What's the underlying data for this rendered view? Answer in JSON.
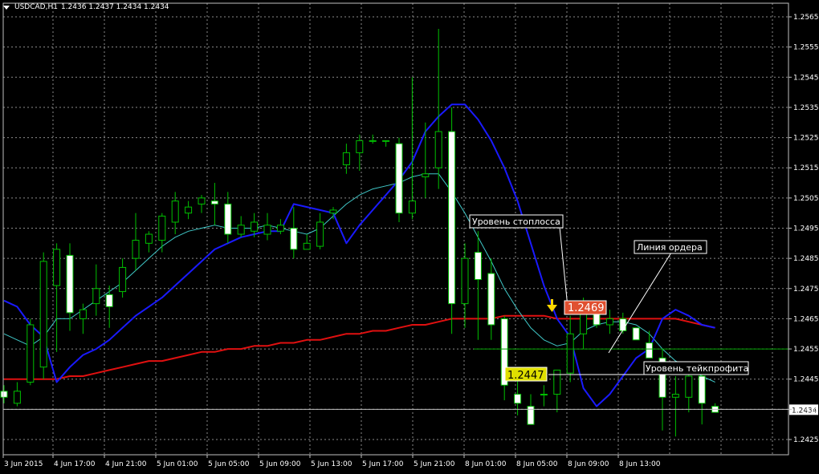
{
  "header": {
    "symbol": "USDCAD,H1",
    "ohlc": "1.2436 1.2437 1.2434 1.2434"
  },
  "price_axis": {
    "labels": [
      "1.2565",
      "1.2555",
      "1.2545",
      "1.2535",
      "1.2525",
      "1.2515",
      "1.2505",
      "1.2495",
      "1.2485",
      "1.2475",
      "1.2465",
      "1.2455",
      "1.2445",
      "1.2435",
      "1.2425"
    ],
    "current_price": "1.2434"
  },
  "time_axis": {
    "labels": [
      "3 Jun 2015",
      "4 Jun 17:00",
      "4 Jun 21:00",
      "5 Jun 01:00",
      "5 Jun 05:00",
      "5 Jun 09:00",
      "5 Jun 13:00",
      "5 Jun 17:00",
      "5 Jun 21:00",
      "8 Jun 01:00",
      "8 Jun 05:00",
      "8 Jun 09:00",
      "8 Jun 13:00"
    ]
  },
  "annotations": {
    "stoploss_label": "Уровень стоплосса",
    "order_line_label": "Линия ордера",
    "takeprofit_label": "Уровень тейкпрофита",
    "stoploss_price": "1.2469",
    "takeprofit_price": "1.2447"
  },
  "colors": {
    "background": "#000000",
    "grid": "#8a8a8a",
    "bull_candle": "#00c000",
    "bear_body": "#ffffff",
    "ma_fast": "#1a1aff",
    "ma_mid": "#40c8c8",
    "ma_slow": "#e01010",
    "order_line": "#00a000",
    "stoploss_bg": "#e05030",
    "takeprofit_bg": "#e0e000",
    "arrow": "#ffd800"
  },
  "chart_data": {
    "type": "candlestick",
    "title": "USDCAD,H1",
    "ylim": [
      1.242,
      1.257
    ],
    "candles": [
      {
        "o": 1.2441,
        "h": 1.2443,
        "l": 1.2437,
        "c": 1.2439
      },
      {
        "o": 1.2437,
        "h": 1.2444,
        "l": 1.2436,
        "c": 1.2441
      },
      {
        "o": 1.2444,
        "h": 1.2465,
        "l": 1.2443,
        "c": 1.2463
      },
      {
        "o": 1.2449,
        "h": 1.2487,
        "l": 1.2445,
        "c": 1.2484
      },
      {
        "o": 1.2476,
        "h": 1.249,
        "l": 1.2454,
        "c": 1.2488
      },
      {
        "o": 1.2486,
        "h": 1.249,
        "l": 1.2461,
        "c": 1.2467
      },
      {
        "o": 1.2465,
        "h": 1.247,
        "l": 1.246,
        "c": 1.2468
      },
      {
        "o": 1.247,
        "h": 1.2483,
        "l": 1.2466,
        "c": 1.2475
      },
      {
        "o": 1.2473,
        "h": 1.2476,
        "l": 1.2462,
        "c": 1.2469
      },
      {
        "o": 1.2474,
        "h": 1.2485,
        "l": 1.2472,
        "c": 1.2482
      },
      {
        "o": 1.2485,
        "h": 1.25,
        "l": 1.2481,
        "c": 1.2491
      },
      {
        "o": 1.249,
        "h": 1.2494,
        "l": 1.2487,
        "c": 1.2493
      },
      {
        "o": 1.2491,
        "h": 1.25,
        "l": 1.2487,
        "c": 1.2499
      },
      {
        "o": 1.2497,
        "h": 1.2507,
        "l": 1.2493,
        "c": 1.2504
      },
      {
        "o": 1.25,
        "h": 1.2504,
        "l": 1.2498,
        "c": 1.2502
      },
      {
        "o": 1.2503,
        "h": 1.2506,
        "l": 1.25,
        "c": 1.2505
      },
      {
        "o": 1.2504,
        "h": 1.251,
        "l": 1.2496,
        "c": 1.2503
      },
      {
        "o": 1.2503,
        "h": 1.2507,
        "l": 1.249,
        "c": 1.2493
      },
      {
        "o": 1.2493,
        "h": 1.2499,
        "l": 1.2492,
        "c": 1.2496
      },
      {
        "o": 1.2494,
        "h": 1.25,
        "l": 1.2492,
        "c": 1.2497
      },
      {
        "o": 1.2493,
        "h": 1.25,
        "l": 1.2491,
        "c": 1.2496
      },
      {
        "o": 1.2494,
        "h": 1.2498,
        "l": 1.2493,
        "c": 1.2496
      },
      {
        "o": 1.2495,
        "h": 1.2502,
        "l": 1.2485,
        "c": 1.2488
      },
      {
        "o": 1.2488,
        "h": 1.2493,
        "l": 1.2488,
        "c": 1.249
      },
      {
        "o": 1.2489,
        "h": 1.25,
        "l": 1.2488,
        "c": 1.2497
      },
      {
        "o": 1.25,
        "h": 1.2502,
        "l": 1.2498,
        "c": 1.2501
      },
      {
        "o": 1.2516,
        "h": 1.2523,
        "l": 1.2513,
        "c": 1.252
      },
      {
        "o": 1.252,
        "h": 1.2526,
        "l": 1.2514,
        "c": 1.2524
      },
      {
        "o": 1.2524,
        "h": 1.2526,
        "l": 1.2523,
        "c": 1.2524
      },
      {
        "o": 1.2524,
        "h": 1.2524,
        "l": 1.2522,
        "c": 1.2524
      },
      {
        "o": 1.2523,
        "h": 1.2525,
        "l": 1.2497,
        "c": 1.25
      },
      {
        "o": 1.25,
        "h": 1.2545,
        "l": 1.2498,
        "c": 1.2504
      },
      {
        "o": 1.2512,
        "h": 1.253,
        "l": 1.2505,
        "c": 1.2513
      },
      {
        "o": 1.2515,
        "h": 1.2561,
        "l": 1.2508,
        "c": 1.2527
      },
      {
        "o": 1.2527,
        "h": 1.2535,
        "l": 1.246,
        "c": 1.247
      },
      {
        "o": 1.247,
        "h": 1.249,
        "l": 1.2462,
        "c": 1.2485
      },
      {
        "o": 1.2487,
        "h": 1.2494,
        "l": 1.2458,
        "c": 1.2478
      },
      {
        "o": 1.248,
        "h": 1.2485,
        "l": 1.2458,
        "c": 1.2463
      },
      {
        "o": 1.2465,
        "h": 1.2466,
        "l": 1.2438,
        "c": 1.2443
      },
      {
        "o": 1.244,
        "h": 1.2448,
        "l": 1.2433,
        "c": 1.2437
      },
      {
        "o": 1.2436,
        "h": 1.244,
        "l": 1.243,
        "c": 1.243
      },
      {
        "o": 1.244,
        "h": 1.2443,
        "l": 1.2436,
        "c": 1.244
      },
      {
        "o": 1.244,
        "h": 1.2448,
        "l": 1.2434,
        "c": 1.2448
      },
      {
        "o": 1.2447,
        "h": 1.2466,
        "l": 1.2444,
        "c": 1.246
      },
      {
        "o": 1.246,
        "h": 1.2472,
        "l": 1.2455,
        "c": 1.247
      },
      {
        "o": 1.247,
        "h": 1.2471,
        "l": 1.2462,
        "c": 1.2463
      },
      {
        "o": 1.2463,
        "h": 1.2468,
        "l": 1.246,
        "c": 1.2465
      },
      {
        "o": 1.2465,
        "h": 1.2467,
        "l": 1.246,
        "c": 1.2461
      },
      {
        "o": 1.2462,
        "h": 1.2462,
        "l": 1.2458,
        "c": 1.2458
      },
      {
        "o": 1.2457,
        "h": 1.2461,
        "l": 1.2452,
        "c": 1.2452
      },
      {
        "o": 1.2452,
        "h": 1.2455,
        "l": 1.2428,
        "c": 1.2439
      },
      {
        "o": 1.2439,
        "h": 1.2446,
        "l": 1.2426,
        "c": 1.244
      },
      {
        "o": 1.2439,
        "h": 1.2447,
        "l": 1.2434,
        "c": 1.2446
      },
      {
        "o": 1.2446,
        "h": 1.2448,
        "l": 1.243,
        "c": 1.2437
      },
      {
        "o": 1.2436,
        "h": 1.2437,
        "l": 1.2434,
        "c": 1.2434
      }
    ],
    "ma_fast": [
      1.2471,
      1.2469,
      1.2463,
      1.2459,
      1.2444,
      1.2449,
      1.2453,
      1.2455,
      1.2458,
      1.2462,
      1.2466,
      1.2469,
      1.2472,
      1.2476,
      1.248,
      1.2484,
      1.2488,
      1.249,
      1.2492,
      1.2493,
      1.2494,
      1.2494,
      1.2503,
      1.2502,
      1.2501,
      1.25,
      1.249,
      1.2496,
      1.2501,
      1.2506,
      1.2511,
      1.2517,
      1.2527,
      1.2532,
      1.2536,
      1.2536,
      1.2531,
      1.2524,
      1.2515,
      1.2504,
      1.249,
      1.2476,
      1.2465,
      1.2459,
      1.2442,
      1.2436,
      1.244,
      1.2446,
      1.2452,
      1.2455,
      1.2465,
      1.2468,
      1.2466,
      1.2463,
      1.2462
    ],
    "ma_mid": [
      1.246,
      1.2458,
      1.2456,
      1.2459,
      1.2465,
      1.2465,
      1.2468,
      1.2471,
      1.2474,
      1.2477,
      1.2481,
      1.2485,
      1.2489,
      1.2492,
      1.2494,
      1.2495,
      1.2496,
      1.2495,
      1.2495,
      1.2495,
      1.2496,
      1.2495,
      1.2494,
      1.2493,
      1.2495,
      1.2499,
      1.2503,
      1.2506,
      1.2508,
      1.2509,
      1.251,
      1.2512,
      1.2513,
      1.2513,
      1.2507,
      1.25,
      1.2492,
      1.2484,
      1.2475,
      1.2468,
      1.2462,
      1.2458,
      1.2456,
      1.2457,
      1.2461,
      1.2463,
      1.2464,
      1.2464,
      1.2463,
      1.246,
      1.2455,
      1.2451,
      1.2449,
      1.2446,
      1.2444
    ],
    "ma_slow": [
      1.2445,
      1.2445,
      1.2445,
      1.2445,
      1.2445,
      1.2446,
      1.2446,
      1.2447,
      1.2448,
      1.2449,
      1.245,
      1.2451,
      1.2451,
      1.2452,
      1.2453,
      1.2454,
      1.2454,
      1.2455,
      1.2455,
      1.2456,
      1.2456,
      1.2457,
      1.2457,
      1.2458,
      1.2458,
      1.2459,
      1.246,
      1.246,
      1.2461,
      1.2461,
      1.2462,
      1.2463,
      1.2463,
      1.2464,
      1.2465,
      1.2465,
      1.2465,
      1.2465,
      1.2466,
      1.2466,
      1.2466,
      1.2466,
      1.2465,
      1.2465,
      1.2465,
      1.2465,
      1.2465,
      1.2465,
      1.2465,
      1.2465,
      1.2465,
      1.2465,
      1.2464,
      1.2463,
      1.2462
    ],
    "order_line": 1.2455,
    "current_line": 1.2435,
    "stoploss_level": 1.2469,
    "takeprofit_level": 1.2447
  }
}
